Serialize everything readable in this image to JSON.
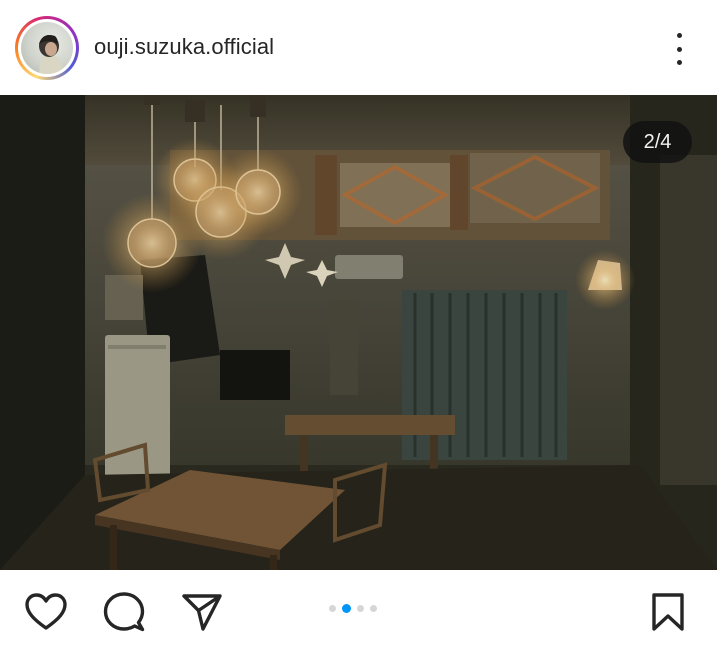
{
  "header": {
    "username": "ouji.suzuka.official"
  },
  "post": {
    "image_counter": "2/4",
    "carousel": {
      "total": 4,
      "current": 2
    }
  },
  "actions": {
    "icons": [
      "heart-icon",
      "comment-icon",
      "share-icon",
      "bookmark-icon"
    ]
  },
  "colors": {
    "accent": "#0095f6",
    "text": "#262626",
    "story_ring": [
      "#feda75",
      "#fa7e1e",
      "#d62976",
      "#962fbf",
      "#4f5bd5"
    ]
  }
}
